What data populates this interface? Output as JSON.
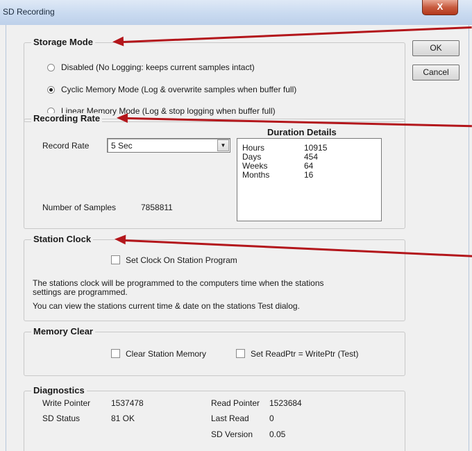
{
  "window": {
    "title": "SD Recording",
    "close_glyph": "X"
  },
  "buttons": {
    "ok": "OK",
    "cancel": "Cancel"
  },
  "storage_mode": {
    "title": "Storage Mode",
    "options": [
      {
        "label": "Disabled (No Logging: keeps current samples intact)",
        "selected": false
      },
      {
        "label": "Cyclic Memory Mode (Log & overwrite samples when buffer full)",
        "selected": true
      },
      {
        "label": "Linear Memory Mode (Log & stop logging when buffer full)",
        "selected": false
      }
    ]
  },
  "recording_rate": {
    "title": "Recording Rate",
    "record_rate_label": "Record Rate",
    "record_rate_value": "5 Sec",
    "samples_label": "Number of Samples",
    "samples_value": "7858811",
    "duration_title": "Duration Details",
    "duration": [
      {
        "label": "Hours",
        "value": "10915"
      },
      {
        "label": "Days",
        "value": "454"
      },
      {
        "label": "Weeks",
        "value": "64"
      },
      {
        "label": "Months",
        "value": "16"
      }
    ]
  },
  "station_clock": {
    "title": "Station Clock",
    "checkbox_label": "Set Clock On Station Program",
    "checked": false,
    "info_line1": "The stations clock will be programmed to the computers time when the stations",
    "info_line2": "settings are programmed.",
    "info_line3": "You can view the stations current time & date on the stations Test dialog."
  },
  "memory_clear": {
    "title": "Memory Clear",
    "clear_label": "Clear Station Memory",
    "readptr_label": "Set ReadPtr = WritePtr (Test)"
  },
  "diagnostics": {
    "title": "Diagnostics",
    "write_pointer_label": "Write Pointer",
    "write_pointer_value": "1537478",
    "sd_status_label": "SD Status",
    "sd_status_value": "81 OK",
    "read_pointer_label": "Read Pointer",
    "read_pointer_value": "1523684",
    "last_read_label": "Last Read",
    "last_read_value": "0",
    "sd_version_label": "SD Version",
    "sd_version_value": "0.05"
  },
  "colors": {
    "annotation_arrow": "#b3161b",
    "dialog_bg": "#f0f0f0"
  }
}
